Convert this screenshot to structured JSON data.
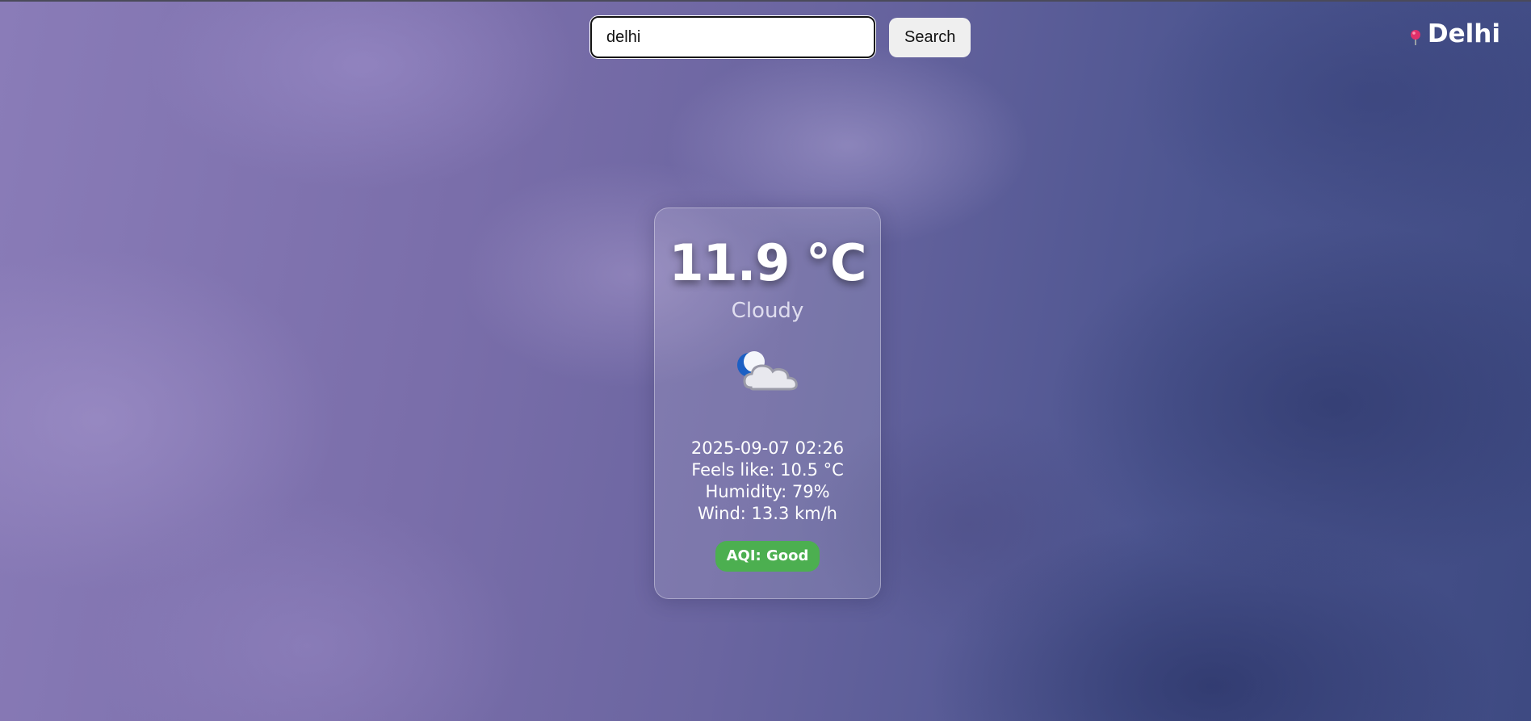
{
  "search": {
    "value": "delhi",
    "button_label": "Search"
  },
  "header": {
    "city": "Delhi",
    "icon": "location-pin-icon",
    "pin_color": "#e0306a"
  },
  "weather": {
    "temperature": "11.9 °C",
    "condition": "Cloudy",
    "icon": "moon-cloud-icon",
    "datetime": "2025-09-07 02:26",
    "feels_like": "Feels like: 10.5 °C",
    "humidity": "Humidity: 79%",
    "wind": "Wind: 13.3 km/h",
    "aqi": "AQI: Good",
    "aqi_color": "#4caf50"
  }
}
